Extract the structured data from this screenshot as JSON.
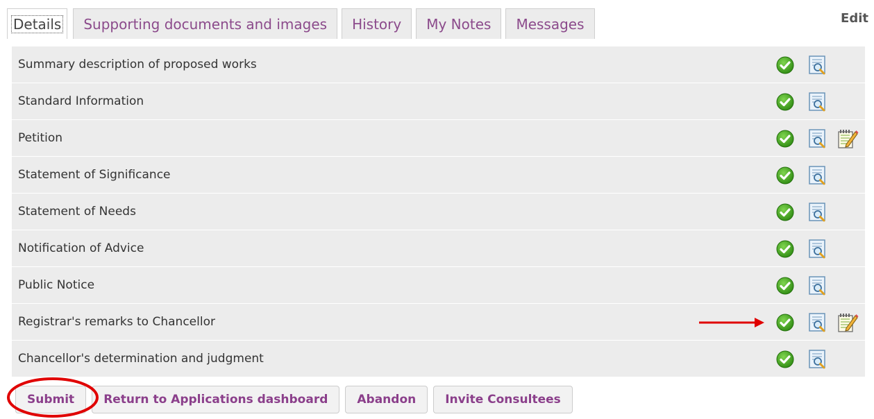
{
  "tabs": [
    {
      "label": "Details",
      "active": true
    },
    {
      "label": "Supporting documents and images",
      "active": false
    },
    {
      "label": "History",
      "active": false
    },
    {
      "label": "My Notes",
      "active": false
    },
    {
      "label": "Messages",
      "active": false
    }
  ],
  "edit_label": "Edit",
  "rows": [
    {
      "label": "Summary description of proposed works",
      "complete": true,
      "editable": false
    },
    {
      "label": "Standard Information",
      "complete": true,
      "editable": false
    },
    {
      "label": "Petition",
      "complete": true,
      "editable": true
    },
    {
      "label": "Statement of Significance",
      "complete": true,
      "editable": false
    },
    {
      "label": "Statement of Needs",
      "complete": true,
      "editable": false
    },
    {
      "label": "Notification of Advice",
      "complete": true,
      "editable": false
    },
    {
      "label": "Public Notice",
      "complete": true,
      "editable": false
    },
    {
      "label": "Registrar's remarks to Chancellor",
      "complete": true,
      "editable": true,
      "arrow_annotation": true
    },
    {
      "label": "Chancellor's determination and judgment",
      "complete": true,
      "editable": false
    }
  ],
  "buttons": {
    "submit": "Submit",
    "return": "Return to Applications dashboard",
    "abandon": "Abandon",
    "invite": "Invite Consultees"
  },
  "icons": {
    "complete": "check-circle-icon",
    "view": "view-document-icon",
    "edit": "edit-notepad-icon"
  },
  "colors": {
    "accent": "#8b3f8b",
    "row_bg": "#ececec",
    "check_green": "#3a9a1c",
    "annotation_red": "#e00000"
  }
}
